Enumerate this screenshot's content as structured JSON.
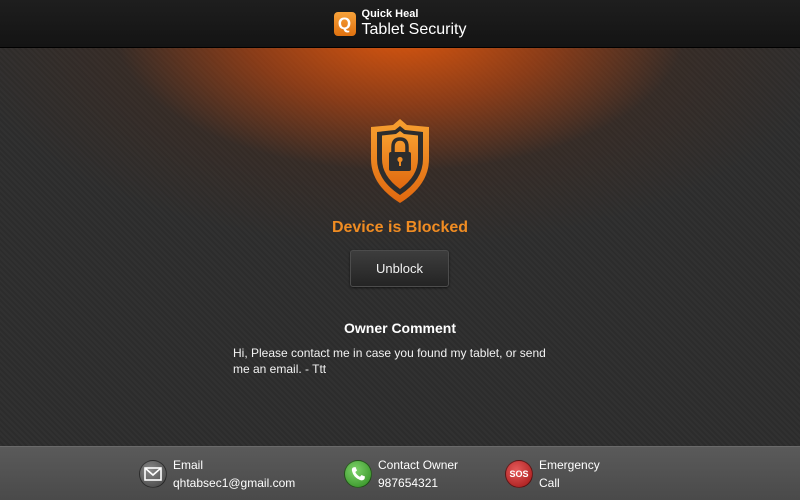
{
  "header": {
    "logo_letter": "Q",
    "brand_line1": "Quick Heal",
    "brand_line2": "Tablet Security"
  },
  "main": {
    "status_title": "Device is Blocked",
    "unblock_label": "Unblock",
    "owner_comment_title": "Owner Comment",
    "owner_comment_text": "Hi, Please contact me in case you found my tablet, or send me an email. - Ttt"
  },
  "footer": {
    "email": {
      "label": "Email",
      "value": "qhtabsec1@gmail.com",
      "icon": "envelope-icon"
    },
    "contact_owner": {
      "label": "Contact Owner",
      "value": "987654321",
      "icon": "phone-icon"
    },
    "emergency": {
      "label": "Emergency",
      "value": "Call",
      "icon_text": "SOS",
      "icon": "sos-icon"
    }
  },
  "colors": {
    "accent_orange": "#f08c22",
    "glow_orange": "#e85a0c",
    "background": "#2e2e2e",
    "footer": "#4f4f4f",
    "phone_green": "#2c8a1e",
    "sos_red": "#a01414"
  }
}
